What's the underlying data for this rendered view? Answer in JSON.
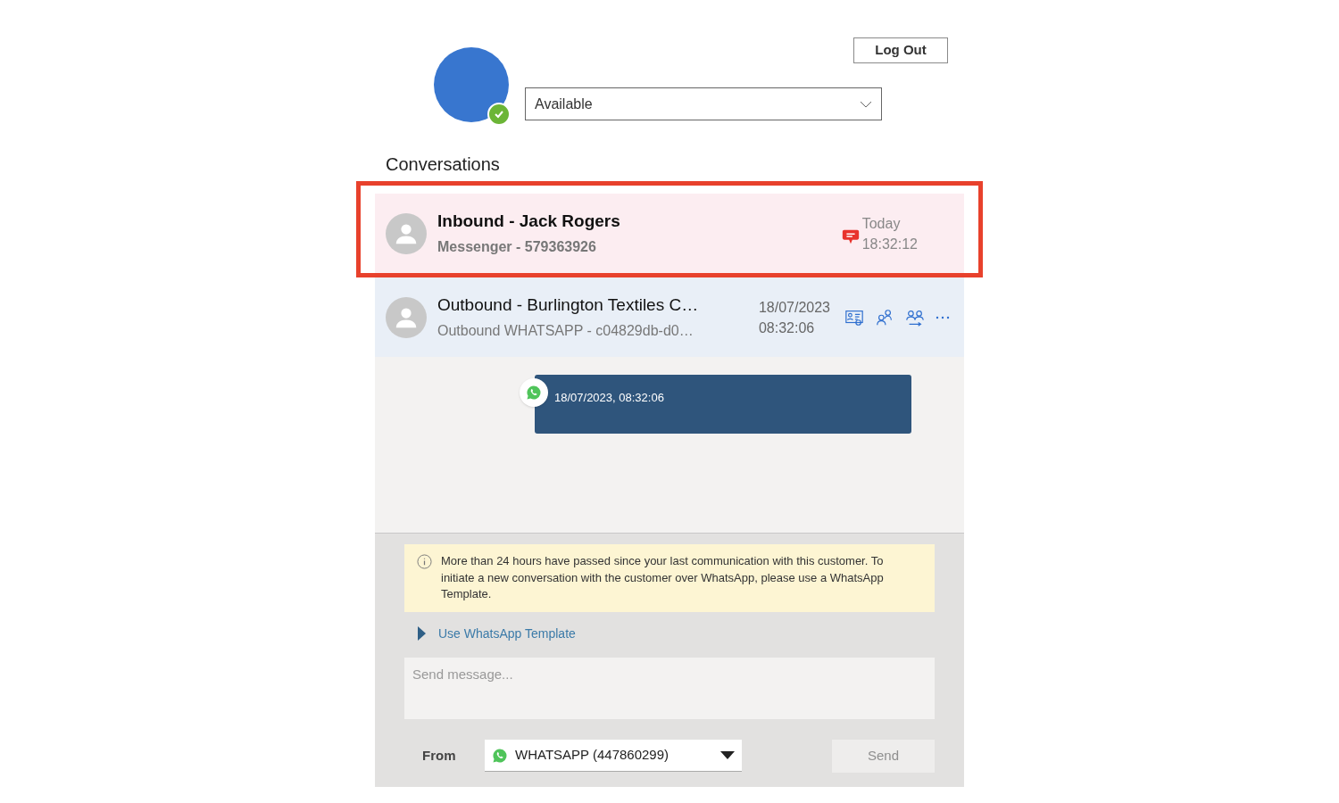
{
  "header": {
    "logout_label": "Log Out",
    "presence": {
      "value": "Available"
    }
  },
  "section_title": "Conversations",
  "conversations": [
    {
      "kind": "inbound",
      "highlighted": true,
      "title": "Inbound - Jack Rogers",
      "subtitle": "Messenger - 579363926",
      "date": "Today",
      "time": "18:32:12"
    },
    {
      "kind": "outbound",
      "highlighted": false,
      "title": "Outbound - Burlington Textiles C…",
      "subtitle": "Outbound WHATSAPP - c04829db-d0…",
      "date": "18/07/2023",
      "time": "08:32:06"
    }
  ],
  "messages": [
    {
      "timestamp": "18/07/2023, 08:32:06"
    }
  ],
  "notice": "More than 24 hours have passed since your last communication with this customer. To initiate a new conversation with the customer over WhatsApp, please use a WhatsApp Template.",
  "template_toggle": {
    "label": "Use WhatsApp Template",
    "expanded": false
  },
  "composer": {
    "placeholder": "Send message...",
    "from_label": "From",
    "from_value": "WHATSAPP (447860299)",
    "send_label": "Send",
    "send_disabled": true
  }
}
